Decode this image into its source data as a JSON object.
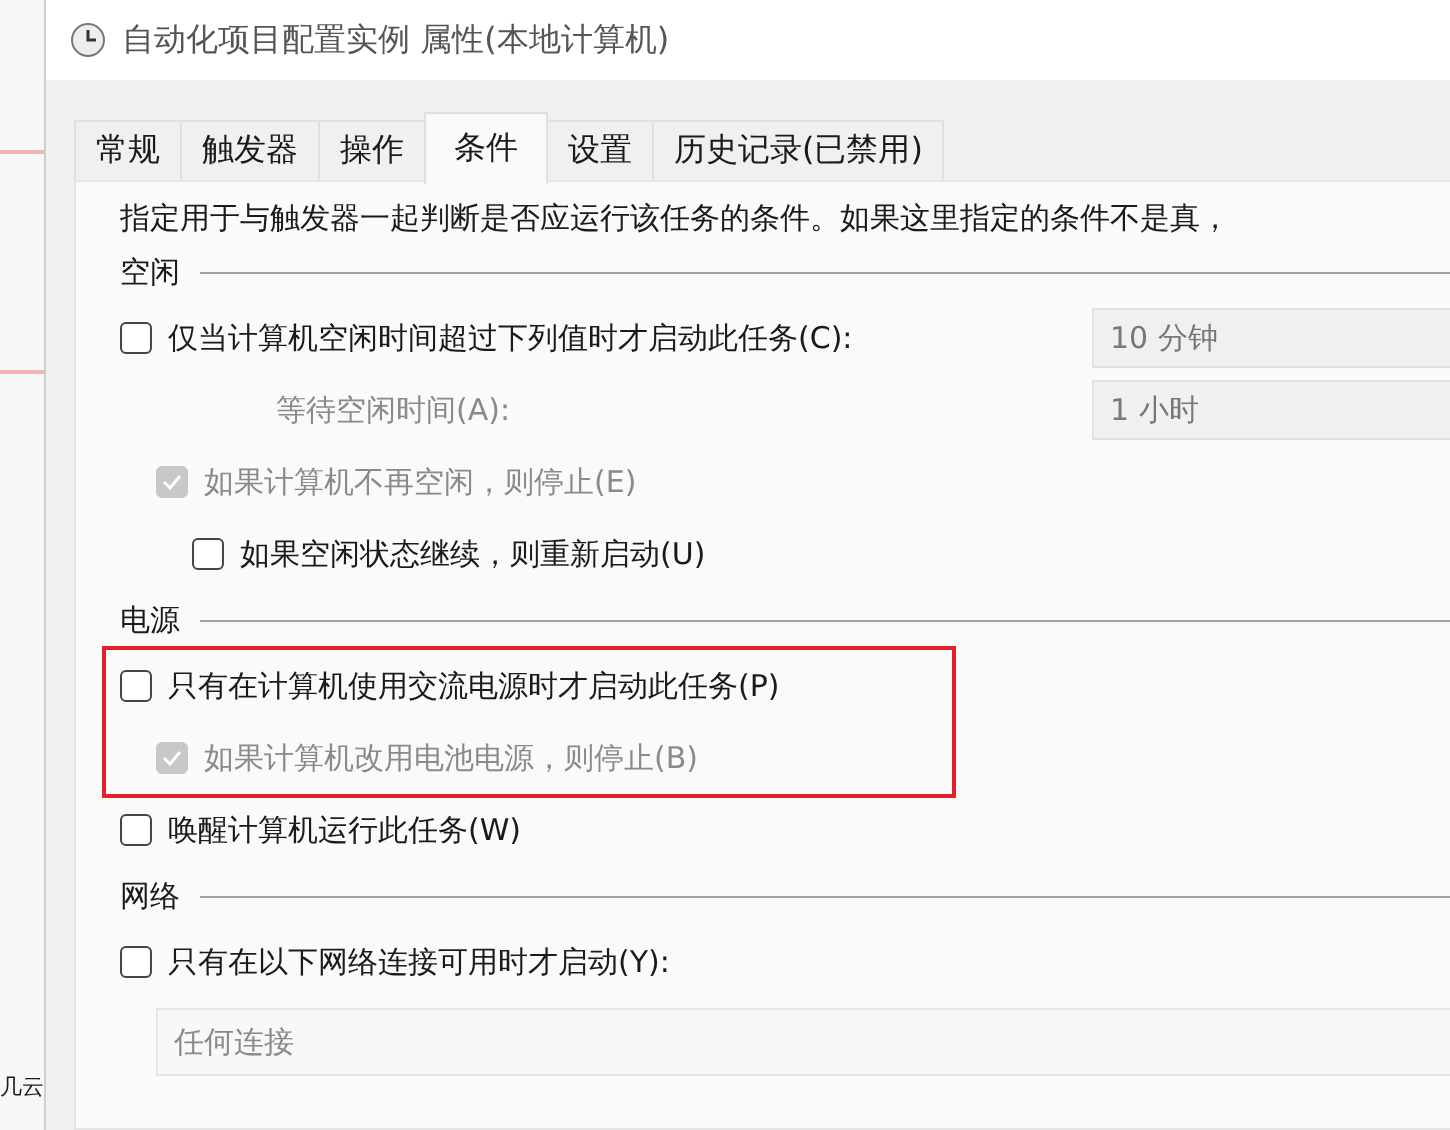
{
  "background": {
    "fragment": "几云"
  },
  "window": {
    "title": "自动化项目配置实例 属性(本地计算机)"
  },
  "tabs": [
    {
      "label": "常规",
      "selected": false
    },
    {
      "label": "触发器",
      "selected": false
    },
    {
      "label": "操作",
      "selected": false
    },
    {
      "label": "条件",
      "selected": true
    },
    {
      "label": "设置",
      "selected": false
    },
    {
      "label": "历史记录(已禁用)",
      "selected": false
    }
  ],
  "description": "指定用于与触发器一起判断是否应运行该任务的条件。如果这里指定的条件不是真，",
  "sections": [
    {
      "title": "空闲",
      "items": [
        {
          "kind": "checkbox",
          "label": "仅当计算机空闲时间超过下列值时才启动此任务(C):",
          "checked": false,
          "disabled": false,
          "value": "10 分钟",
          "children": [
            {
              "kind": "field",
              "label": "等待空闲时间(A):",
              "value": "1 小时",
              "disabled": true
            },
            {
              "kind": "checkbox",
              "label": "如果计算机不再空闲，则停止(E)",
              "checked": true,
              "disabled": true,
              "children": [
                {
                  "kind": "checkbox",
                  "label": "如果空闲状态继续，则重新启动(U)",
                  "checked": false,
                  "disabled": false
                }
              ]
            }
          ]
        }
      ]
    },
    {
      "title": "电源",
      "items": [
        {
          "kind": "checkbox",
          "label": "只有在计算机使用交流电源时才启动此任务(P)",
          "checked": false,
          "disabled": false,
          "highlighted": true,
          "children": [
            {
              "kind": "checkbox",
              "label": "如果计算机改用电池电源，则停止(B)",
              "checked": true,
              "disabled": true
            }
          ]
        },
        {
          "kind": "checkbox",
          "label": "唤醒计算机运行此任务(W)",
          "checked": false,
          "disabled": false
        }
      ]
    },
    {
      "title": "网络",
      "items": [
        {
          "kind": "checkbox",
          "label": "只有在以下网络连接可用时才启动(Y):",
          "checked": false,
          "disabled": false,
          "children": [
            {
              "kind": "combo",
              "value": "任何连接",
              "disabled": true
            }
          ]
        }
      ]
    }
  ]
}
